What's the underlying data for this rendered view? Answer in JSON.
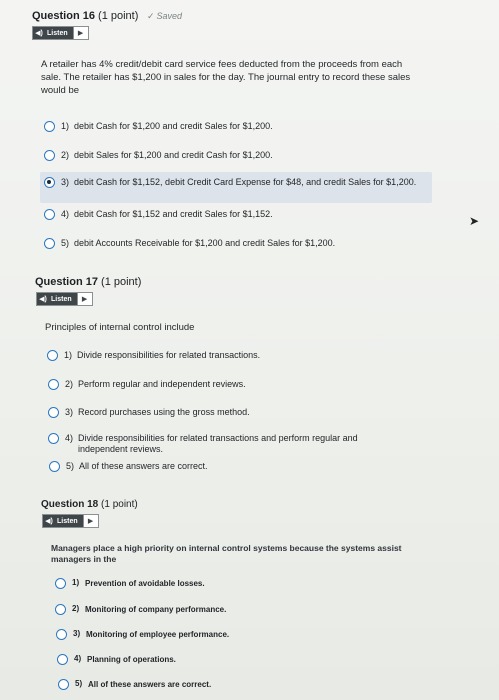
{
  "q16": {
    "title": "Question 16",
    "points": "(1 point)",
    "saved": "Saved",
    "listen": "Listen",
    "prompt": "A retailer has 4% credit/debit card service fees deducted from the proceeds from each sale. The retailer has $1,200 in sales for the day. The journal entry to record these sales would be",
    "options": [
      {
        "num": "1)",
        "text": "debit Cash for $1,200 and credit Sales for $1,200."
      },
      {
        "num": "2)",
        "text": "debit Sales for $1,200 and credit Cash for $1,200."
      },
      {
        "num": "3)",
        "text": "debit Cash for $1,152, debit Credit Card Expense for $48, and credit Sales for $1,200."
      },
      {
        "num": "4)",
        "text": "debit Cash for $1,152 and credit Sales for $1,152."
      },
      {
        "num": "5)",
        "text": "debit Accounts Receivable for $1,200 and credit Sales for $1,200."
      }
    ],
    "selected_index": 2
  },
  "q17": {
    "title": "Question 17",
    "points": "(1 point)",
    "listen": "Listen",
    "prompt": "Principles of internal control include",
    "options": [
      {
        "num": "1)",
        "text": "Divide responsibilities for related transactions."
      },
      {
        "num": "2)",
        "text": "Perform regular and independent reviews."
      },
      {
        "num": "3)",
        "text": "Record purchases using the gross method."
      },
      {
        "num": "4)",
        "text": "Divide responsibilities for related transactions and perform regular and independent reviews."
      },
      {
        "num": "5)",
        "text": "All of these answers are correct."
      }
    ]
  },
  "q18": {
    "title": "Question 18",
    "points": "(1 point)",
    "listen": "Listen",
    "prompt": "Managers place a high priority on internal control systems because the systems assist managers in the",
    "options": [
      {
        "num": "1)",
        "text": "Prevention of avoidable losses."
      },
      {
        "num": "2)",
        "text": "Monitoring of company performance."
      },
      {
        "num": "3)",
        "text": "Monitoring of employee performance."
      },
      {
        "num": "4)",
        "text": "Planning of operations."
      },
      {
        "num": "5)",
        "text": "All of these answers are correct."
      }
    ]
  },
  "icons": {
    "speaker": "speaker-icon",
    "play": "play-icon",
    "check": "check-icon",
    "cursor": "mouse-cursor-icon"
  },
  "colors": {
    "radio_border": "#2c77c0",
    "selected_bg": "#dde3ea",
    "listen_dark": "#3f4649"
  }
}
